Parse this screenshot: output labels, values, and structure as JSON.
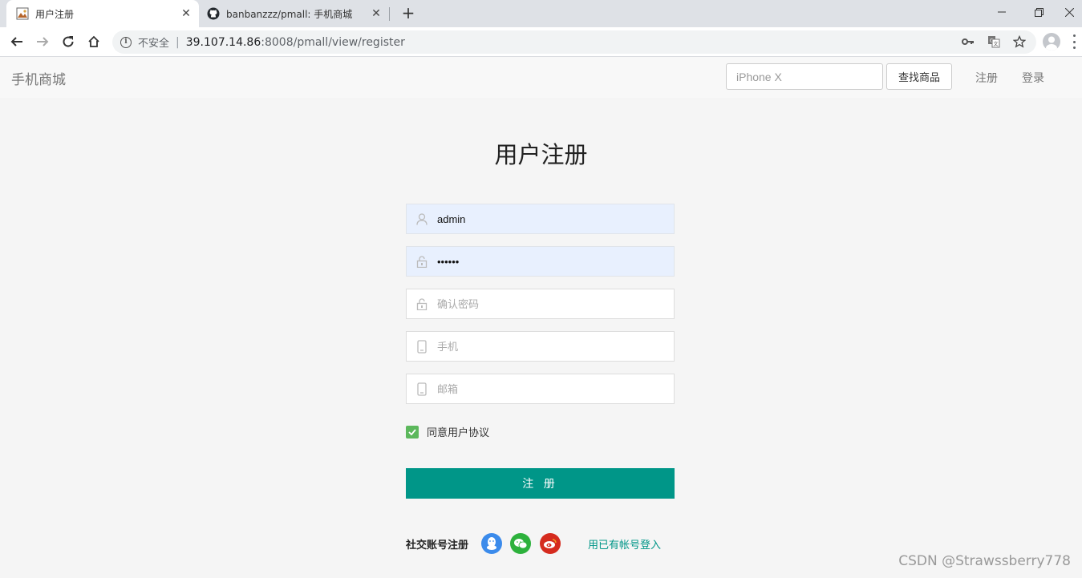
{
  "browser": {
    "tabs": [
      {
        "title": "用户注册",
        "active": true
      },
      {
        "title": "banbanzzz/pmall: 手机商城",
        "active": false
      }
    ],
    "address": {
      "insecure_label": "不安全",
      "host": "39.107.14.86",
      "path": ":8008/pmall/view/register"
    }
  },
  "header": {
    "brand": "手机商城",
    "search_placeholder": "iPhone X",
    "search_button": "查找商品",
    "register_link": "注册",
    "login_link": "登录"
  },
  "form": {
    "title": "用户注册",
    "username_value": "admin",
    "password_value": "••••••",
    "confirm_placeholder": "确认密码",
    "phone_placeholder": "手机",
    "email_placeholder": "邮箱",
    "agree_label": "同意用户协议",
    "agree_checked": true,
    "submit_label": "注 册"
  },
  "social": {
    "label": "社交账号注册",
    "icons": [
      "qq-icon",
      "wechat-icon",
      "weibo-icon"
    ],
    "login_link": "用已有帐号登入"
  },
  "colors": {
    "primary": "#009688",
    "checkbox": "#5cb85c",
    "qq": "#3b8beb",
    "wechat": "#2db13c",
    "weibo": "#d52b1e"
  },
  "watermark": "CSDN @Strawssberry778"
}
